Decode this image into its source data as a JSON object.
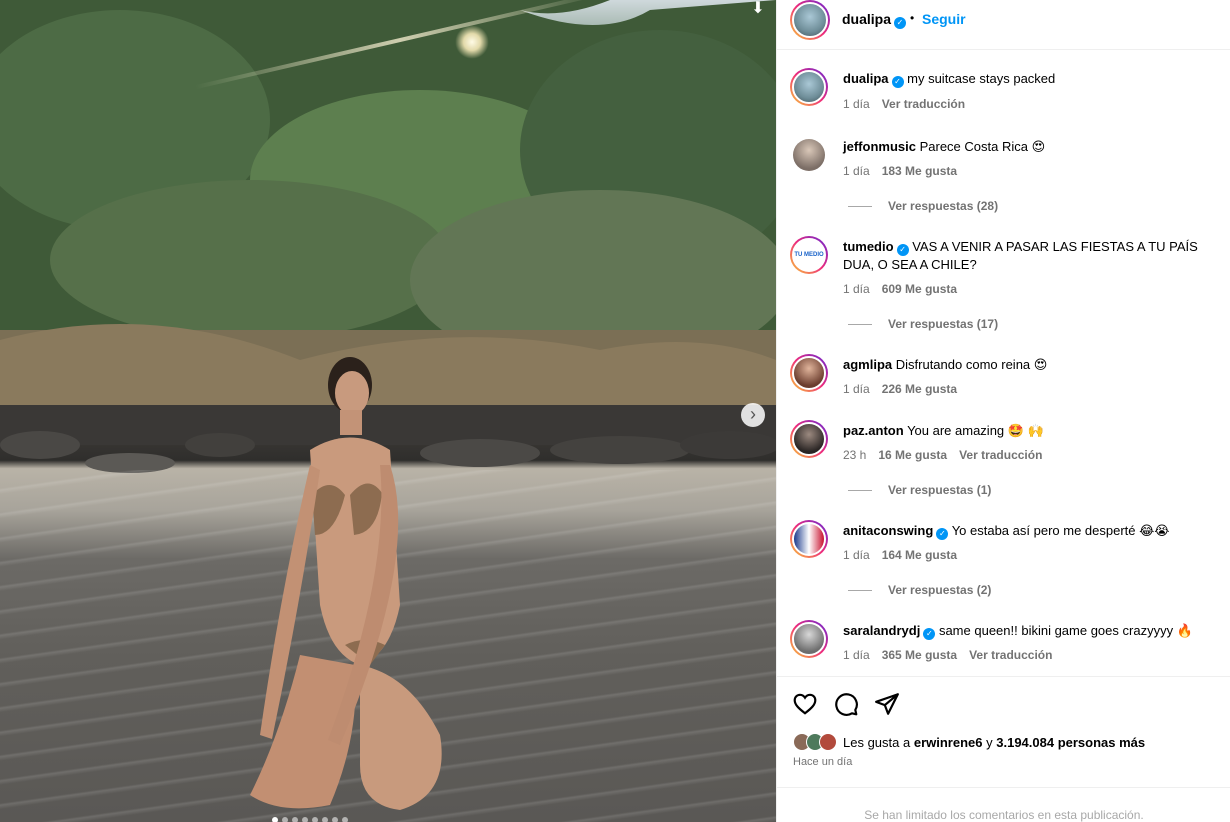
{
  "post": {
    "author": "dualipa",
    "follow_label": "Seguir",
    "separator": "•",
    "caption": "my suitcase stays packed",
    "caption_time": "1 día",
    "caption_translate": "Ver traducción"
  },
  "comments": [
    {
      "user": "jeffonmusic",
      "verified": false,
      "text": "Parece Costa Rica 😍",
      "time": "1 día",
      "likes": "183 Me gusta",
      "translate": "",
      "replies": "Ver respuestas (28)"
    },
    {
      "user": "tumedio",
      "verified": true,
      "text": "VAS A VENIR A PASAR LAS FIESTAS A TU PAÍS DUA, O SEA A CHILE?",
      "time": "1 día",
      "likes": "609 Me gusta",
      "translate": "",
      "replies": "Ver respuestas (17)"
    },
    {
      "user": "agmlipa",
      "verified": false,
      "text": "Disfrutando como reina 😍",
      "time": "1 día",
      "likes": "226 Me gusta",
      "translate": "",
      "replies": ""
    },
    {
      "user": "paz.anton",
      "verified": false,
      "text": "You are amazing 🤩 🙌",
      "time": "23 h",
      "likes": "16 Me gusta",
      "translate": "Ver traducción",
      "replies": "Ver respuestas (1)"
    },
    {
      "user": "anitaconswing",
      "verified": true,
      "text": "Yo estaba así pero me desperté 😂😭",
      "time": "1 día",
      "likes": "164 Me gusta",
      "translate": "",
      "replies": "Ver respuestas (2)"
    },
    {
      "user": "saralandrydj",
      "verified": true,
      "text": "same queen!! bikini game goes crazyyyy 🔥",
      "time": "1 día",
      "likes": "365 Me gusta",
      "translate": "Ver traducción",
      "replies": ""
    }
  ],
  "likes_summary": {
    "prefix": "Les gusta a ",
    "user": "erwinrene6",
    "mid": " y ",
    "others": "3.194.084 personas más"
  },
  "time_ago": "Hace un día",
  "limited_notice": "Se han limitado los comentarios en esta publicación.",
  "icons": [
    "heart-icon",
    "comment-icon",
    "share-icon",
    "download-icon",
    "chevron-right-icon",
    "verified-icon"
  ],
  "colors": {
    "accent": "#0095f6",
    "muted": "#737373",
    "border": "#efefef"
  }
}
